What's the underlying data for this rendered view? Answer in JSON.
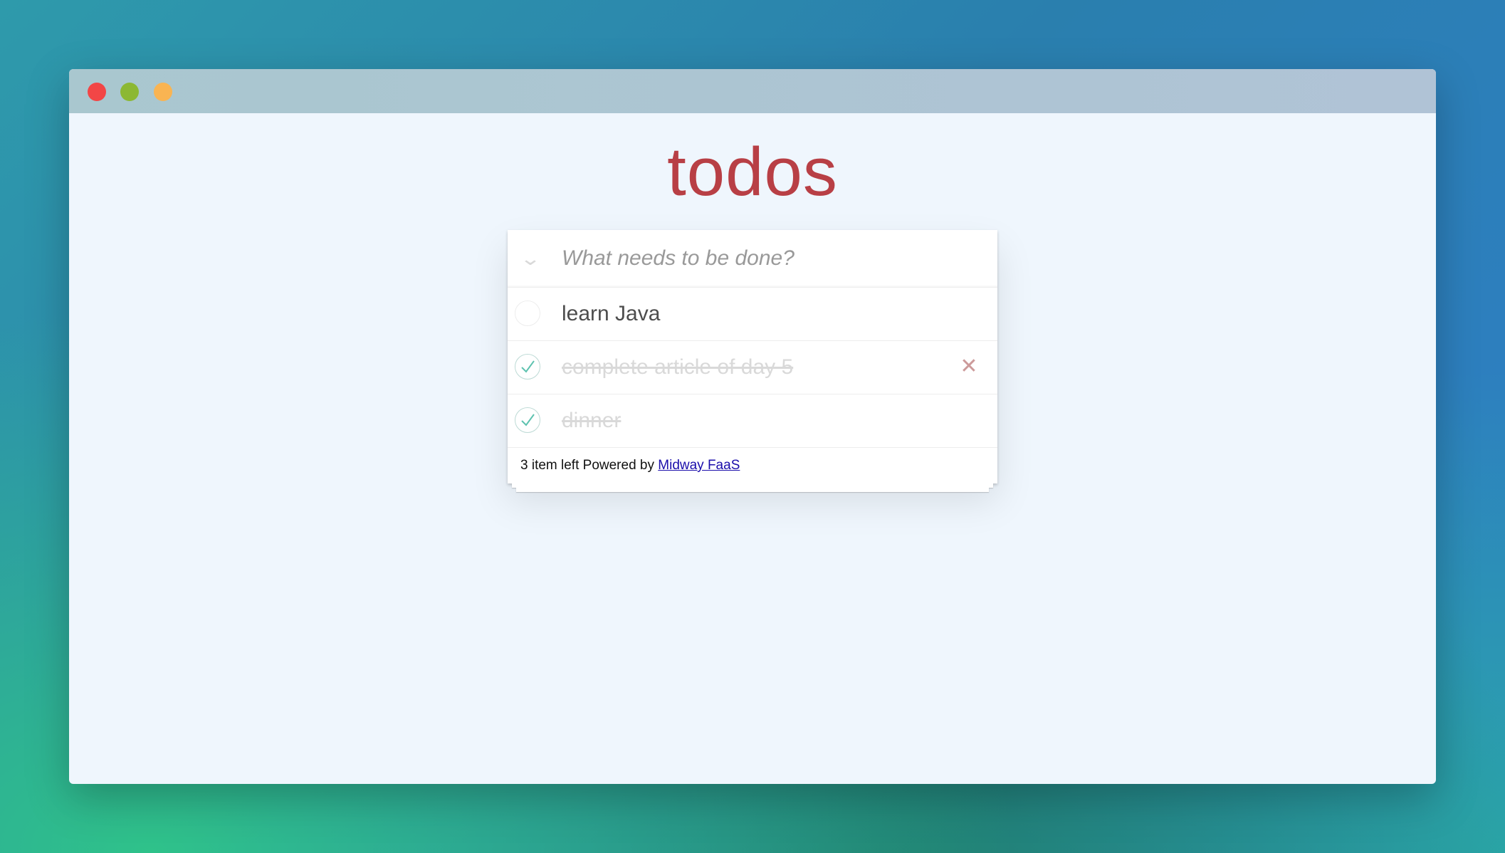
{
  "app": {
    "title": "todos"
  },
  "window": {
    "controls": [
      "close",
      "minimize",
      "maximize"
    ],
    "colors": {
      "close": "#f24646",
      "minimize": "#8cb833",
      "maximize": "#f9b452"
    }
  },
  "input": {
    "placeholder": "What needs to be done?",
    "value": ""
  },
  "todos": [
    {
      "label": "learn Java",
      "completed": false
    },
    {
      "label": "complete article of day 5",
      "completed": true
    },
    {
      "label": "dinner",
      "completed": true
    }
  ],
  "footer": {
    "count_text": "3 item left Powered by ",
    "link_text": "Midway FaaS"
  },
  "icons": {
    "toggle_all": "chevron-down-icon",
    "check": "checkmark-icon",
    "destroy": "close-icon"
  },
  "theme": {
    "title_color": "#b83f45",
    "check_color": "#5dc2af",
    "destroy_color": "#cc9a9a",
    "link_color": "#1a0dab"
  }
}
